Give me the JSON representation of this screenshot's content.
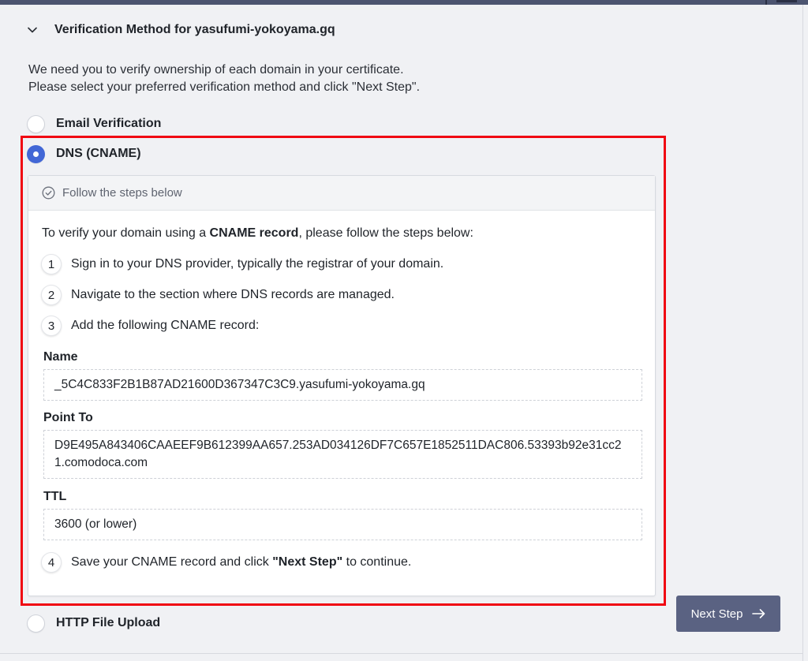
{
  "section": {
    "title": "Verification Method for yasufumi-yokoyama.gq",
    "intro_line1": "We need you to verify ownership of each domain in your certificate.",
    "intro_line2": "Please select your preferred verification method and click \"Next Step\"."
  },
  "methods": {
    "email": "Email Verification",
    "dns": "DNS (CNAME)",
    "http": "HTTP File Upload",
    "selected": "dns"
  },
  "card": {
    "header": "Follow the steps below",
    "intro_prefix": "To verify your domain using a ",
    "intro_bold": "CNAME record",
    "intro_suffix": ", please follow the steps below:",
    "steps": [
      {
        "num": "1",
        "text": "Sign in to your DNS provider, typically the registrar of your domain."
      },
      {
        "num": "2",
        "text": "Navigate to the section where DNS records are managed."
      },
      {
        "num": "3",
        "text": "Add the following CNAME record:"
      },
      {
        "num": "4",
        "text_prefix": "Save your CNAME record and click ",
        "text_bold": "\"Next Step\"",
        "text_suffix": " to continue."
      }
    ],
    "fields": {
      "name_label": "Name",
      "name_value": "_5C4C833F2B1B87AD21600D367347C3C9.yasufumi-yokoyama.gq",
      "point_label": "Point To",
      "point_value": "D9E495A843406CAAEEF9B612399AA657.253AD034126DF7C657E1852511DAC806.53393b92e31cc21.comodoca.com",
      "ttl_label": "TTL",
      "ttl_value": "3600 (or lower)"
    }
  },
  "next_button": "Next Step",
  "colors": {
    "accent": "#4267d6",
    "highlight": "#f00712",
    "button": "#5a6282"
  },
  "icons": [
    "chevron-down-icon",
    "check-circle-icon",
    "arrow-right-icon"
  ]
}
